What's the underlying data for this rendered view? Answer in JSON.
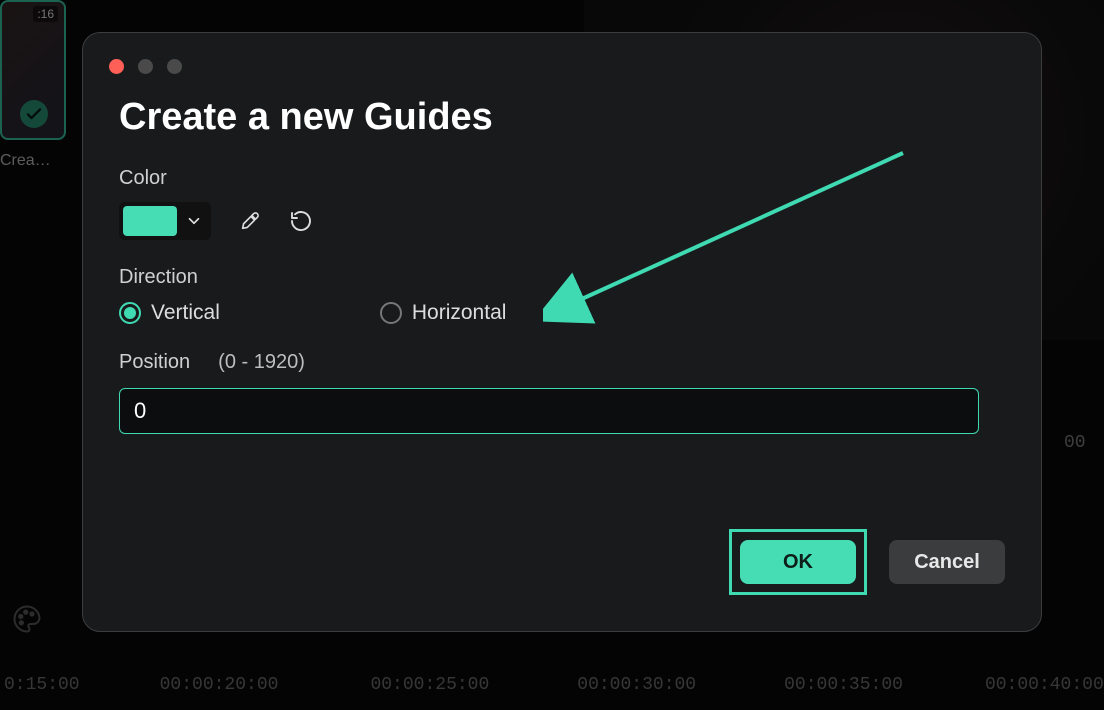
{
  "background": {
    "thumb_duration": ":16",
    "thumb_label": "Crea…",
    "timecodes": [
      "0:15:00",
      "00:00:20:00",
      "00:00:25:00",
      "00:00:30:00",
      "00:00:35:00",
      "00:00:40:00"
    ],
    "right_partial_time": "00"
  },
  "dialog": {
    "title": "Create a new Guides",
    "color_label": "Color",
    "color_hex": "#46dcb4",
    "direction_label": "Direction",
    "direction_options": {
      "vertical": "Vertical",
      "horizontal": "Horizontal"
    },
    "direction_selected": "vertical",
    "position_label": "Position",
    "position_range": "(0 - 1920)",
    "position_value": "0",
    "ok_label": "OK",
    "cancel_label": "Cancel"
  },
  "icons": {
    "check": "check-icon",
    "chevron": "chevron-down-icon",
    "eyedropper": "eyedropper-icon",
    "reset": "reset-icon",
    "palette": "palette-icon"
  }
}
